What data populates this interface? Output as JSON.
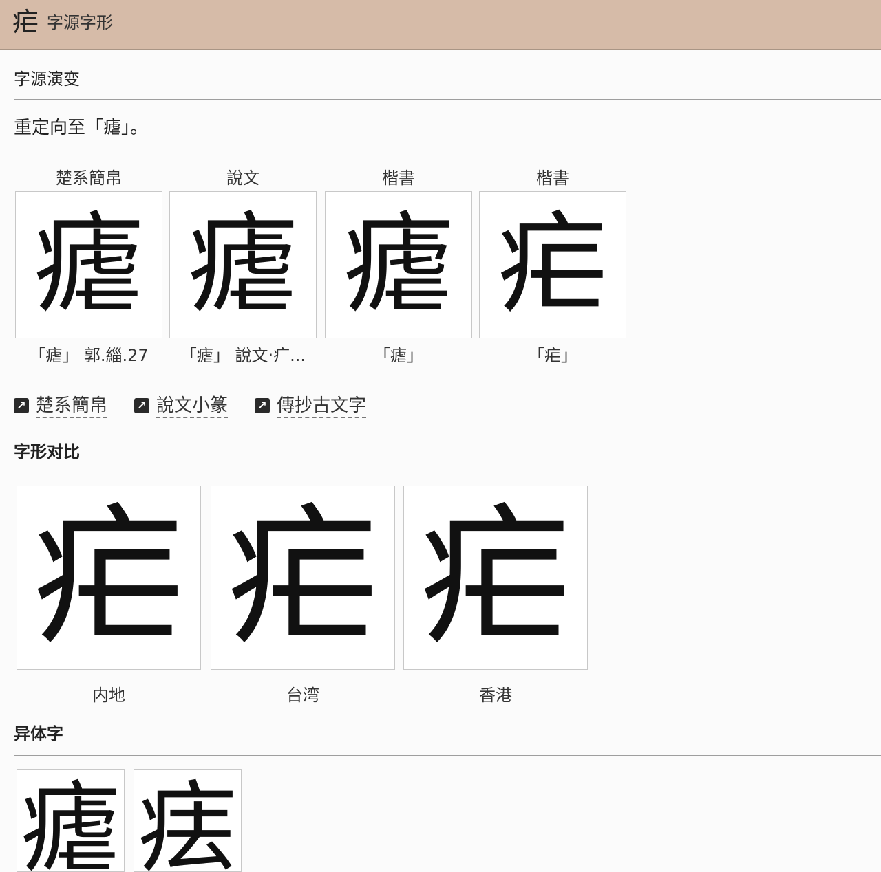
{
  "header": {
    "glyph": "疟",
    "title": "字源字形"
  },
  "evolution": {
    "title": "字源演变",
    "note": "重定向至「瘧」。",
    "items": [
      {
        "label": "楚系簡帛",
        "glyph": "瘧",
        "caption": "「瘧」 郭.緇.27"
      },
      {
        "label": "說文",
        "glyph": "瘧",
        "caption": "「瘧」 說文‧疒..."
      },
      {
        "label": "楷書",
        "glyph": "瘧",
        "caption": "「瘧」"
      },
      {
        "label": "楷書",
        "glyph": "疟",
        "caption": "「疟」"
      }
    ],
    "links": [
      {
        "icon": "external-link-icon",
        "label": "楚系簡帛"
      },
      {
        "icon": "external-link-icon",
        "label": "說文小篆"
      },
      {
        "icon": "external-link-icon",
        "label": "傳抄古文字"
      }
    ]
  },
  "comparison": {
    "title": "字形对比",
    "items": [
      {
        "glyph": "疟",
        "label": "内地"
      },
      {
        "glyph": "疟",
        "label": "台湾"
      },
      {
        "glyph": "疟",
        "label": "香港"
      }
    ]
  },
  "variants": {
    "title": "异体字",
    "items": [
      {
        "glyph": "瘧"
      },
      {
        "glyph": "㾀"
      }
    ]
  }
}
